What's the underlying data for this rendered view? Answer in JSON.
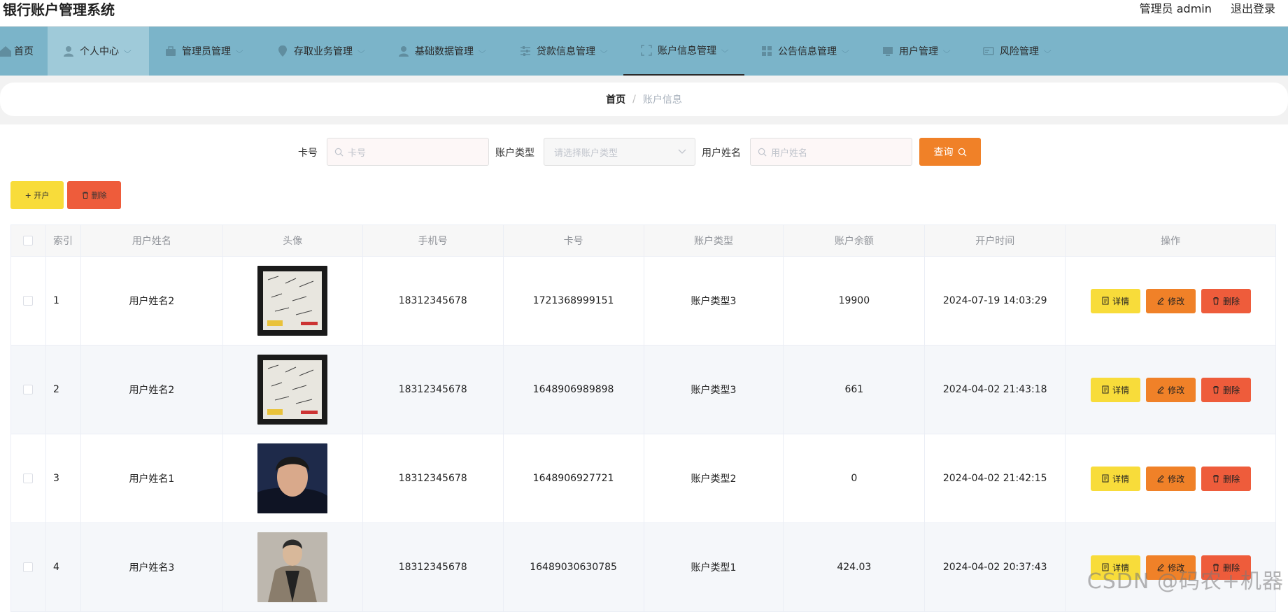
{
  "header": {
    "title": "银行账户管理系统",
    "admin_label": "管理员 admin",
    "logout_label": "退出登录"
  },
  "nav": {
    "home": "首页",
    "items": [
      {
        "label": "个人中心",
        "icon": "user-icon"
      },
      {
        "label": "管理员管理",
        "icon": "briefcase-icon"
      },
      {
        "label": "存取业务管理",
        "icon": "pin-icon"
      },
      {
        "label": "基础数据管理",
        "icon": "user-icon"
      },
      {
        "label": "贷款信息管理",
        "icon": "sliders-icon"
      },
      {
        "label": "账户信息管理",
        "icon": "frame-icon"
      },
      {
        "label": "公告信息管理",
        "icon": "grid-icon"
      },
      {
        "label": "用户管理",
        "icon": "monitor-icon"
      },
      {
        "label": "风险管理",
        "icon": "card-icon"
      }
    ]
  },
  "breadcrumb": {
    "home": "首页",
    "separator": "/",
    "current": "账户信息"
  },
  "search": {
    "card_label": "卡号",
    "card_placeholder": "卡号",
    "type_label": "账户类型",
    "type_placeholder": "请选择账户类型",
    "name_label": "用户姓名",
    "name_placeholder": "用户姓名",
    "query_label": "查询"
  },
  "actions": {
    "open_label": "+ 开户",
    "delete_label": "删除"
  },
  "table": {
    "headers": [
      "索引",
      "用户姓名",
      "头像",
      "手机号",
      "卡号",
      "账户类型",
      "账户余额",
      "开户时间",
      "操作"
    ],
    "ops": {
      "detail": "详情",
      "edit": "修改",
      "delete": "删除"
    },
    "rows": [
      {
        "index": "1",
        "name": "用户姓名2",
        "phone": "18312345678",
        "card": "1721368999151",
        "type": "账户类型3",
        "balance": "19900",
        "time": "2024-07-19 14:03:29"
      },
      {
        "index": "2",
        "name": "用户姓名2",
        "phone": "18312345678",
        "card": "1648906989898",
        "type": "账户类型3",
        "balance": "661",
        "time": "2024-04-02 21:43:18"
      },
      {
        "index": "3",
        "name": "用户姓名1",
        "phone": "18312345678",
        "card": "1648906927721",
        "type": "账户类型2",
        "balance": "0",
        "time": "2024-04-02 21:42:15"
      },
      {
        "index": "4",
        "name": "用户姓名3",
        "phone": "18312345678",
        "card": "16489030630785",
        "type": "账户类型1",
        "balance": "424.03",
        "time": "2024-04-02 20:37:43"
      }
    ]
  },
  "watermark": "CSDN @码农+机器",
  "colors": {
    "nav_bg": "#7bb4c9",
    "primary_orange": "#f08128",
    "yellow": "#f8dc3a",
    "red": "#ee5c3b"
  }
}
